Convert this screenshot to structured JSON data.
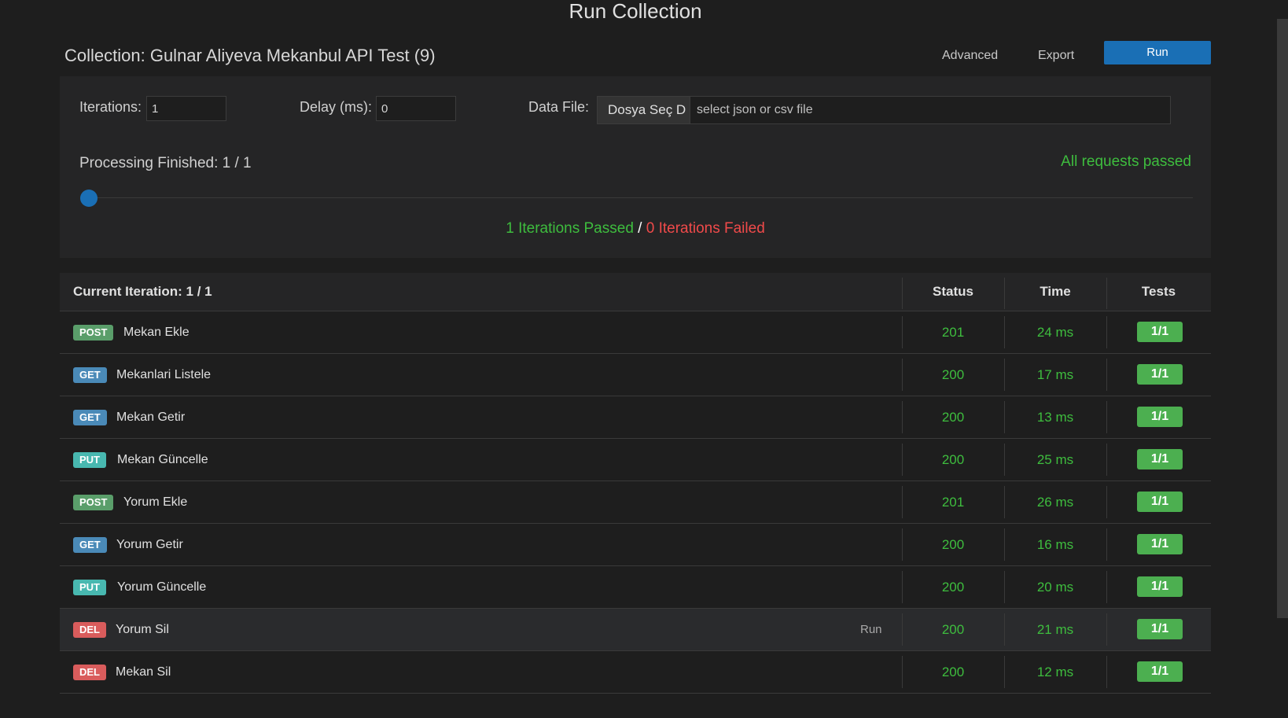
{
  "page": {
    "title": "Run Collection"
  },
  "header": {
    "collection_name": "Collection: Gulnar Aliyeva Mekanbul API Test (9)",
    "advanced_label": "Advanced",
    "export_label": "Export",
    "run_label": "Run"
  },
  "settings": {
    "iterations_label": "Iterations:",
    "iterations_value": "1",
    "delay_label": "Delay (ms):",
    "delay_value": "0",
    "data_file_label": "Data File:",
    "file_button_label": "Dosya Seç D",
    "file_placeholder": "select json or csv file"
  },
  "progress": {
    "processing_label": "Processing Finished: 1 / 1",
    "status_text": "All requests passed",
    "fraction": 1.0,
    "iterations_passed": "1 Iterations Passed",
    "separator": "/",
    "iterations_failed": "0 Iterations Failed"
  },
  "table": {
    "header_name": "Current Iteration: 1 / 1",
    "header_status": "Status",
    "header_time": "Time",
    "header_tests": "Tests",
    "rows": [
      {
        "method": "POST",
        "name": "Mekan Ekle",
        "status": "201",
        "time": "24 ms",
        "tests": "1/1"
      },
      {
        "method": "GET",
        "name": "Mekanlari Listele",
        "status": "200",
        "time": "17 ms",
        "tests": "1/1"
      },
      {
        "method": "GET",
        "name": "Mekan Getir",
        "status": "200",
        "time": "13 ms",
        "tests": "1/1"
      },
      {
        "method": "PUT",
        "name": "Mekan Güncelle",
        "status": "200",
        "time": "25 ms",
        "tests": "1/1"
      },
      {
        "method": "POST",
        "name": "Yorum Ekle",
        "status": "201",
        "time": "26 ms",
        "tests": "1/1"
      },
      {
        "method": "GET",
        "name": "Yorum Getir",
        "status": "200",
        "time": "16 ms",
        "tests": "1/1"
      },
      {
        "method": "PUT",
        "name": "Yorum Güncelle",
        "status": "200",
        "time": "20 ms",
        "tests": "1/1"
      },
      {
        "method": "DEL",
        "name": "Yorum Sil",
        "status": "200",
        "time": "21 ms",
        "tests": "1/1",
        "run_label": "Run"
      },
      {
        "method": "DEL",
        "name": "Mekan Sil",
        "status": "200",
        "time": "12 ms",
        "tests": "1/1"
      }
    ]
  },
  "colors": {
    "pass": "#3ebd3e",
    "fail": "#f04a4a",
    "accent": "#1a6fb5",
    "post": "#5a9e6a",
    "get": "#4a8ab8",
    "put": "#48b8b0",
    "del": "#d95c5c"
  }
}
